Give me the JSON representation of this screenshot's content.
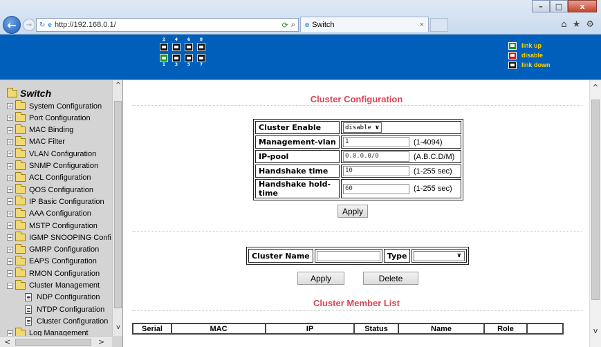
{
  "browser": {
    "url": "http://192.168.0.1/",
    "tab_title": "Switch",
    "win_minimize": "–",
    "win_maximize": "□",
    "win_close": "x",
    "back": "←",
    "forward": "→",
    "search_icon": "⌕",
    "tab_close": "×",
    "home_icon": "⌂",
    "fav_icon": "★",
    "settings_icon": "⚙"
  },
  "banner": {
    "ports_top": [
      "2",
      "4",
      "6",
      "8"
    ],
    "ports_bottom": [
      "1",
      "3",
      "5",
      "7"
    ],
    "port_up": [
      1
    ],
    "legend": [
      {
        "label": "link up",
        "color": "#1a9a1a"
      },
      {
        "label": "disable",
        "color": "#e01010"
      },
      {
        "label": "link down",
        "color": "#111111"
      }
    ]
  },
  "sidebar": {
    "root": "Switch",
    "items": [
      {
        "label": "System Configuration"
      },
      {
        "label": "Port Configuration"
      },
      {
        "label": "MAC Binding"
      },
      {
        "label": "MAC Filter"
      },
      {
        "label": "VLAN Configuration"
      },
      {
        "label": "SNMP Configuration"
      },
      {
        "label": "ACL Configuration"
      },
      {
        "label": "QOS Configuration"
      },
      {
        "label": "IP Basic Configuration"
      },
      {
        "label": "AAA Configuration"
      },
      {
        "label": "MSTP Configuration"
      },
      {
        "label": "IGMP SNOOPING Confi"
      },
      {
        "label": "GMRP Configuration"
      },
      {
        "label": "EAPS Configuration"
      },
      {
        "label": "RMON Configuration"
      },
      {
        "label": "Cluster Management"
      }
    ],
    "children": [
      {
        "label": "NDP Configuration"
      },
      {
        "label": "NTDP Configuration"
      },
      {
        "label": "Cluster Configuration"
      }
    ],
    "last": "Log Management"
  },
  "cluster_config": {
    "title": "Cluster Configuration",
    "fields": [
      {
        "label": "Cluster Enable",
        "value": "disable",
        "hint": ""
      },
      {
        "label": "Management-vlan",
        "value": "1",
        "hint": "(1-4094)"
      },
      {
        "label": "IP-pool",
        "value": "0.0.0.0/0",
        "hint": "(A.B.C.D/M)"
      },
      {
        "label": "Handshake time",
        "value": "10",
        "hint": "(1-255 sec)"
      },
      {
        "label": "Handshake hold-time",
        "value": "60",
        "hint": "(1-255 sec)"
      }
    ],
    "apply_label": "Apply"
  },
  "cluster_name": {
    "name_label": "Cluster Name",
    "name_value": "",
    "type_label": "Type",
    "type_value": "",
    "apply_label": "Apply",
    "delete_label": "Delete"
  },
  "member_list": {
    "title": "Cluster Member List",
    "columns": [
      "Serial",
      "MAC",
      "IP",
      "Status",
      "Name",
      "Role",
      ""
    ]
  }
}
